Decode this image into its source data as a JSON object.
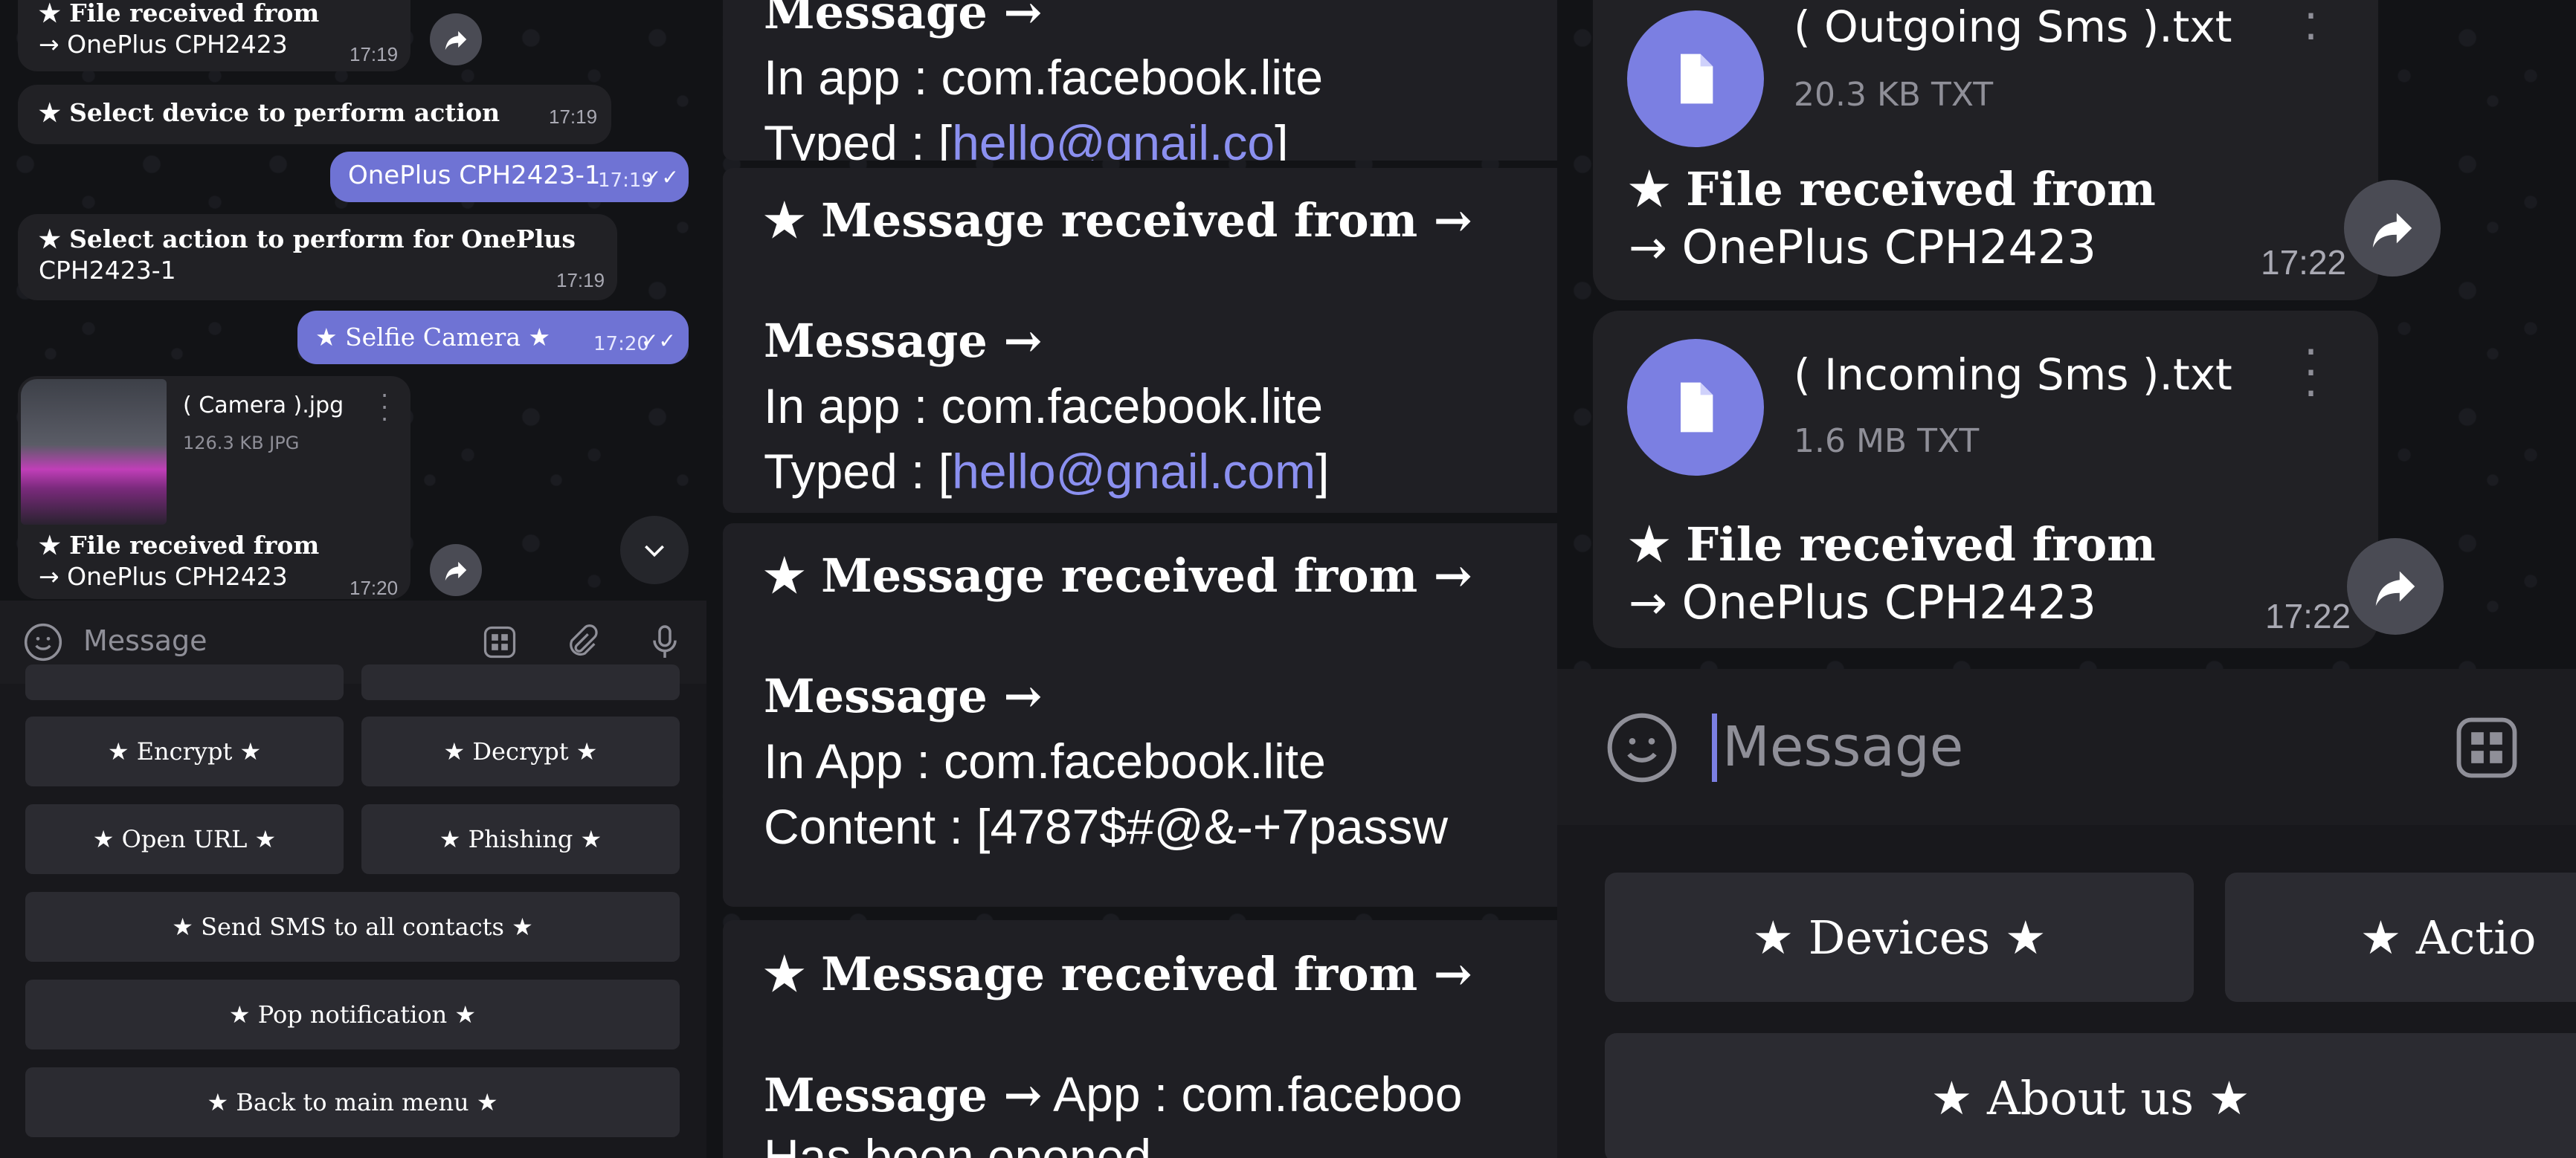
{
  "left": {
    "msg1": {
      "title": "★ File received from",
      "device": "→ OnePlus CPH2423",
      "time": "17:19"
    },
    "msg2": {
      "text": "★ Select device to perform action",
      "time": "17:19"
    },
    "msg3": {
      "text": "OnePlus CPH2423-1",
      "time": "17:19"
    },
    "msg4": {
      "line1": "★ Select action to perform for OnePlus",
      "line2": "CPH2423-1",
      "time": "17:19"
    },
    "msg5": {
      "text": "★ Selfie Camera ★",
      "time": "17:20"
    },
    "file": {
      "name": "( Camera ).jpg",
      "size": "126.3 KB JPG",
      "caption1": "★ File received from",
      "caption2": "→ OnePlus CPH2423",
      "time": "17:20"
    },
    "input_placeholder": "Message",
    "keyboard": {
      "encrypt": "★ Encrypt ★",
      "decrypt": "★ Decrypt ★",
      "open_url": "★ Open URL ★",
      "phishing": "★ Phishing ★",
      "send_sms": "★ Send SMS to all contacts ★",
      "pop_notification": "★ Pop notification ★",
      "back": "★ Back to main menu ★"
    }
  },
  "middle": {
    "block0": {
      "head": "Message →",
      "line1": "In app : com.facebook.lite",
      "typed_prefix": "Typed : [",
      "typed_value": "hello@gnail.co",
      "typed_suffix": "]"
    },
    "block1": {
      "head": "★ Message received from →",
      "sub": "Message →",
      "line1": "In app : com.facebook.lite",
      "typed_prefix": "Typed : [",
      "typed_value": "hello@gnail.com",
      "typed_suffix": "]"
    },
    "block2": {
      "head": "★ Message received from →",
      "sub": "Message →",
      "line1": "In App : com.facebook.lite",
      "line2": "Content : [4787$#@&-+7passw"
    },
    "block3": {
      "head": "★ Message received from →",
      "sub": "Message →",
      "sub_rest": " App : com.faceboo",
      "line2": "Has been opened"
    }
  },
  "right": {
    "file1": {
      "name": "( Outgoing Sms ).txt",
      "size": "20.3 KB TXT",
      "caption1": "★ File received from",
      "caption2": "→ OnePlus CPH2423",
      "time": "17:22"
    },
    "file2": {
      "name": "( Incoming Sms ).txt",
      "size": "1.6 MB TXT",
      "caption1": "★ File received from",
      "caption2": "→ OnePlus CPH2423",
      "time": "17:22"
    },
    "input_placeholder": "Message",
    "keyboard": {
      "devices": "★ Devices ★",
      "actions": "★ Actio",
      "about": "★ About us ★"
    }
  },
  "colors": {
    "accent": "#6f73d4",
    "link": "#8b90f0",
    "bubble": "#212125",
    "button": "#2b2b31"
  }
}
